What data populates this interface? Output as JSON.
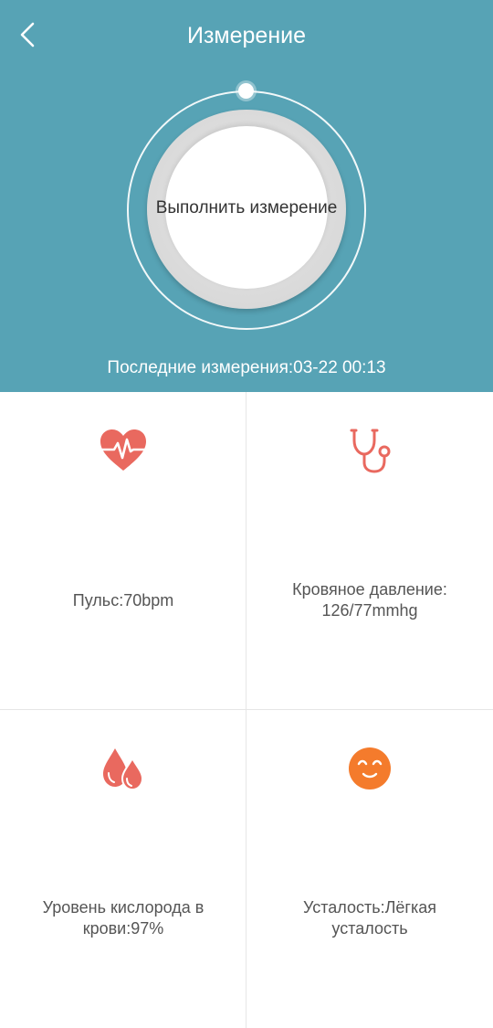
{
  "header": {
    "title": "Измерение",
    "back_icon": "chevron-left-icon",
    "background_color": "#57a3b5"
  },
  "measure": {
    "button_label": "Выполнить измерение",
    "last_measurement": "Последние измерения:03-22 00:13"
  },
  "metrics": [
    {
      "icon": "heart-pulse-icon",
      "icon_color": "#e9695f",
      "lines": [
        "Пульс:70bpm"
      ]
    },
    {
      "icon": "stethoscope-icon",
      "icon_color": "#e9695f",
      "lines": [
        "Кровяное давление:",
        "126/77mmhg"
      ]
    },
    {
      "icon": "blood-drops-icon",
      "icon_color": "#e9695f",
      "lines": [
        "Уровень кислорода в",
        "крови:97%"
      ]
    },
    {
      "icon": "smiley-face-icon",
      "icon_color": "#f47b2c",
      "lines": [
        "Усталость:Лёгкая",
        "усталость"
      ]
    }
  ]
}
